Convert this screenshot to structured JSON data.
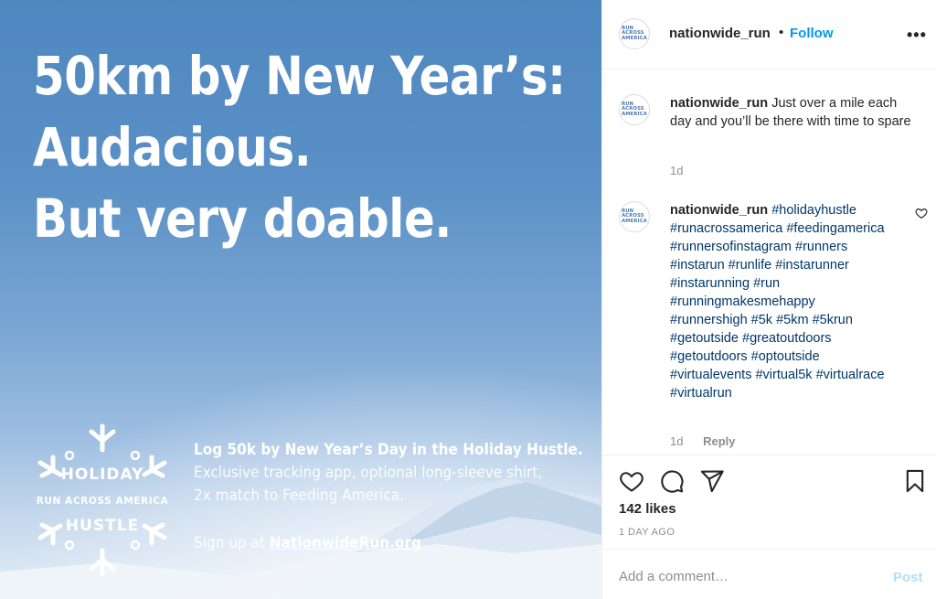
{
  "image": {
    "headline": [
      "50km by New Year’s:",
      "Audacious.",
      "But very doable."
    ],
    "promo_bold": "Log 50k by New Year’s Day in the Holiday Hustle.",
    "promo_lines": [
      "Exclusive tracking app, optional long-sleeve shirt,",
      "2x match to Feeding America."
    ],
    "signup_prefix": "Sign up at ",
    "signup_link": "NationwideRun.org",
    "snowflake": {
      "top": "HOLIDAY",
      "middle": "RUN ACROSS AMERICA",
      "bottom": "HUSTLE"
    }
  },
  "avatar_logo": [
    "RUN",
    "ACROSS",
    "AMERICA"
  ],
  "header": {
    "username": "nationwide_run",
    "separator": "•",
    "follow_label": "Follow",
    "more_icon": "more-horizontal-icon"
  },
  "comments": [
    {
      "username": "nationwide_run",
      "text": "Just over a mile each day and you’ll be there with time to spare",
      "time": "1d"
    },
    {
      "username": "nationwide_run",
      "hashtags": "#holidayhustle #runacrossamerica #feedingamerica #runnersofinstagram #runners #instarun #runlife #instarunner #instarunning #run #runningmakesmehappy #runnershigh #5k #5km #5krun #getoutside #greatoutdoors #getoutdoors #optoutside #virtualevents #virtual5k #virtualrace #virtualrun",
      "time": "1d",
      "reply_label": "Reply"
    }
  ],
  "actions": {
    "likes": "142 likes",
    "date": "1 DAY AGO"
  },
  "add_comment": {
    "placeholder": "Add a comment…",
    "post_label": "Post"
  },
  "colors": {
    "link_blue": "#0095f6",
    "hashtag_blue": "#00376b",
    "muted": "#8e8e8e",
    "post_disabled": "#b2dffc"
  }
}
